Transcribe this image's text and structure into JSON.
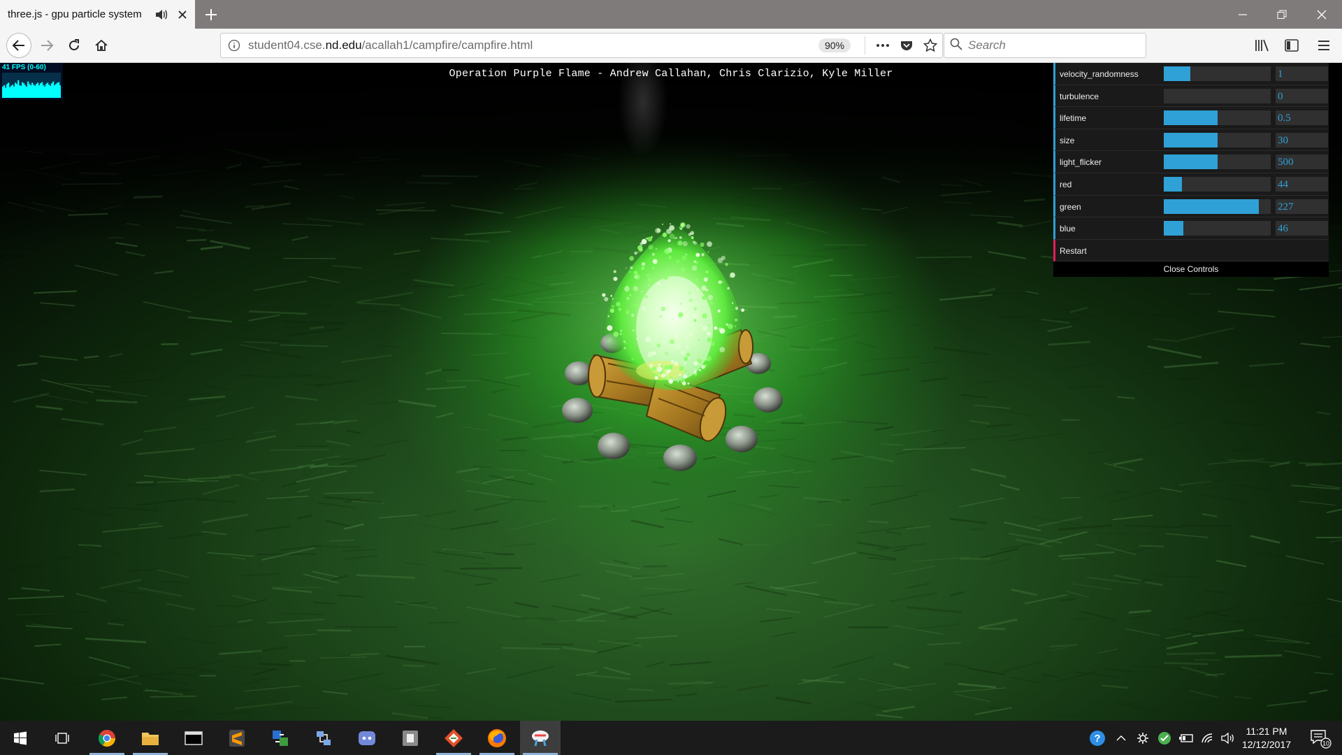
{
  "browser": {
    "tab_title": "three.js - gpu particle system",
    "url_prefix": "student04.cse.",
    "url_domain": "nd.edu",
    "url_path": "/acallah1/campfire/campfire.html",
    "zoom": "90%",
    "search_placeholder": "Search"
  },
  "scene": {
    "title": "Operation Purple Flame - Andrew Callahan, Chris Clarizio, Kyle Miller"
  },
  "stats": {
    "label": "41 FPS (0-60)",
    "fps_history": [
      0.45,
      0.5,
      0.4,
      0.55,
      0.6,
      0.42,
      0.48,
      0.52,
      0.45,
      0.6,
      0.55,
      0.7,
      0.5,
      0.48,
      0.62,
      0.58,
      0.5,
      0.44,
      0.65,
      0.55,
      0.5,
      0.6,
      0.52,
      0.48,
      0.55,
      0.6,
      0.5,
      0.58,
      0.62,
      0.5,
      0.45,
      0.55,
      0.6,
      0.52,
      0.48,
      0.58,
      0.65,
      0.5,
      0.55,
      0.6,
      0.62,
      0.5
    ]
  },
  "controls": [
    {
      "label": "velocity_randomness",
      "value": "1",
      "fill": 0.25
    },
    {
      "label": "turbulence",
      "value": "0",
      "fill": 0.0
    },
    {
      "label": "lifetime",
      "value": "0.5",
      "fill": 0.5
    },
    {
      "label": "size",
      "value": "30",
      "fill": 0.5
    },
    {
      "label": "light_flicker",
      "value": "500",
      "fill": 0.5
    },
    {
      "label": "red",
      "value": "44",
      "fill": 0.17
    },
    {
      "label": "green",
      "value": "227",
      "fill": 0.89
    },
    {
      "label": "blue",
      "value": "46",
      "fill": 0.18
    }
  ],
  "restart_label": "Restart",
  "close_controls_label": "Close Controls",
  "clock": {
    "time": "11:21 PM",
    "date": "12/12/2017"
  },
  "notifications_count": "10",
  "colors": {
    "gui_accent": "#2fa1d6",
    "restart_accent": "#e61d5f",
    "flame": "#7dff5a"
  },
  "taskbar_icons": [
    "windows-start-icon",
    "task-view-icon",
    "chrome-icon",
    "file-explorer-icon",
    "terminal-icon",
    "sublime-text-icon",
    "app-transfer-icon",
    "network-icon",
    "discord-icon",
    "app-gray-icon",
    "git-icon",
    "firefox-icon",
    "app-paint-icon"
  ],
  "tray_icons": [
    "help-icon",
    "chevron-up-icon",
    "settings-tray-icon",
    "app-green-icon",
    "battery-icon",
    "wifi-icon",
    "volume-icon"
  ]
}
